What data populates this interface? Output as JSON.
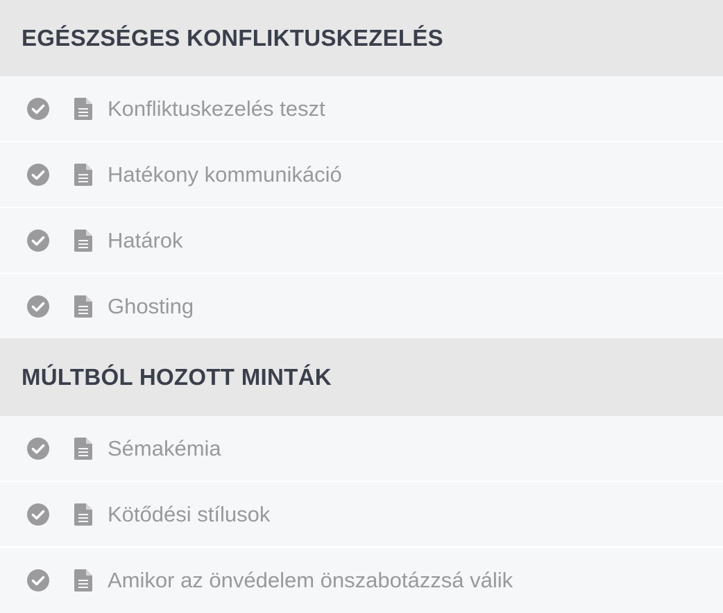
{
  "sections": [
    {
      "title": "EGÉSZSÉGES KONFLIKTUSKEZELÉS",
      "lessons": [
        {
          "label": "Konfliktuskezelés teszt",
          "completed": true,
          "icon": "document-icon"
        },
        {
          "label": "Hatékony kommunikáció",
          "completed": true,
          "icon": "document-icon"
        },
        {
          "label": "Határok",
          "completed": true,
          "icon": "document-icon"
        },
        {
          "label": "Ghosting",
          "completed": true,
          "icon": "document-icon"
        }
      ]
    },
    {
      "title": "MÚLTBÓL HOZOTT MINTÁK",
      "lessons": [
        {
          "label": "Sémakémia",
          "completed": true,
          "icon": "document-icon"
        },
        {
          "label": "Kötődési stílusok",
          "completed": true,
          "icon": "document-icon"
        },
        {
          "label": "Amikor az önvédelem önszabotázzsá válik",
          "completed": true,
          "icon": "document-icon"
        }
      ]
    }
  ],
  "colors": {
    "header_bg": "#e7e7e8",
    "row_bg": "#f6f7f9",
    "title_text": "#3a3f4b",
    "label_text": "#98999b",
    "icon_gray": "#9b9b9d"
  }
}
